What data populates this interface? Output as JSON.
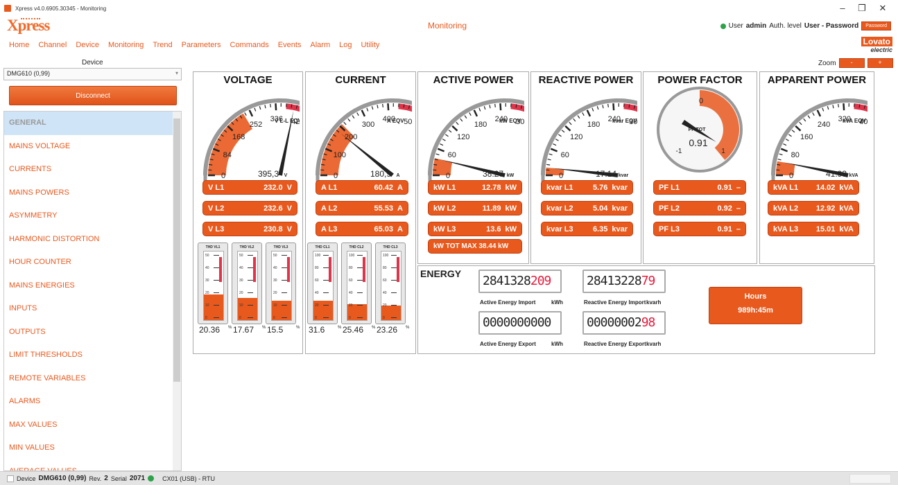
{
  "window": {
    "title": "Xpress v4.0.6905.30345 - Monitoring",
    "minimize": "–",
    "maximize": "❐",
    "close": "✕"
  },
  "app": {
    "logo": "Xpress",
    "page_title": "Monitoring"
  },
  "user": {
    "user_label": "User",
    "user_name": "admin",
    "auth_label": "Auth. level",
    "auth_value": "User - Password",
    "password_button": "Password"
  },
  "menu": [
    "Home",
    "Channel",
    "Device",
    "Monitoring",
    "Trend",
    "Parameters",
    "Commands",
    "Events",
    "Alarm",
    "Log",
    "Utility"
  ],
  "brand": {
    "name": "Lovato",
    "sub": "electric"
  },
  "device": {
    "label": "Device",
    "selected": "DMG610 (0,99)",
    "disconnect": "Disconnect"
  },
  "zoom": {
    "label": "Zoom",
    "minus": "-",
    "plus": "+"
  },
  "nav": {
    "active_index": 0,
    "items": [
      "GENERAL",
      "MAINS VOLTAGE",
      "CURRENTS",
      "MAINS POWERS",
      "ASYMMETRY",
      "HARMONIC DISTORTION",
      "HOUR COUNTER",
      "MAINS ENERGIES",
      "INPUTS",
      "OUTPUTS",
      "LIMIT THRESHOLDS",
      "REMOTE VARIABLES",
      "ALARMS",
      "MAX VALUES",
      "MIN VALUES",
      "AVERAGE VALUES"
    ]
  },
  "panels": {
    "voltage": {
      "title": "VOLTAGE",
      "gauge": {
        "ticks": [
          "0",
          "84",
          "168",
          "252",
          "336",
          "420"
        ],
        "unit": "V L-L EQV",
        "readout": "395,3",
        "readout_unit": "V",
        "max": 420,
        "value": 395.3,
        "fill_value": 230
      },
      "rows": [
        {
          "label": "V L1",
          "value": "232.0",
          "unit": "V"
        },
        {
          "label": "V L2",
          "value": "232.6",
          "unit": "V"
        },
        {
          "label": "V L3",
          "value": "230.8",
          "unit": "V"
        }
      ],
      "thd": [
        {
          "label": "THD VL1",
          "scale": [
            "50",
            "40",
            "30",
            "20",
            "10",
            "0"
          ],
          "max": 50,
          "value": 20.36,
          "display": "20.36",
          "unit": "%"
        },
        {
          "label": "THD VL2",
          "scale": [
            "50",
            "40",
            "30",
            "20",
            "10",
            "0"
          ],
          "max": 50,
          "value": 17.67,
          "display": "17.67",
          "unit": "%"
        },
        {
          "label": "THD VL3",
          "scale": [
            "50",
            "40",
            "30",
            "20",
            "10",
            "0"
          ],
          "max": 50,
          "value": 15.5,
          "display": "15.5",
          "unit": "%"
        }
      ]
    },
    "current": {
      "title": "CURRENT",
      "gauge": {
        "ticks": [
          "0",
          "100",
          "200",
          "300",
          "400",
          "500"
        ],
        "unit": "A EQV",
        "readout": "180,9",
        "readout_unit": "A",
        "max": 500,
        "value": 180.9,
        "fill_value": 210
      },
      "rows": [
        {
          "label": "A L1",
          "value": "60.42",
          "unit": "A"
        },
        {
          "label": "A L2",
          "value": "55.53",
          "unit": "A"
        },
        {
          "label": "A L3",
          "value": "65.03",
          "unit": "A"
        }
      ],
      "thd": [
        {
          "label": "THD CL1",
          "scale": [
            "100",
            "80",
            "60",
            "40",
            "20",
            "0"
          ],
          "max": 100,
          "value": 31.6,
          "display": "31.6",
          "unit": "%"
        },
        {
          "label": "THD CL2",
          "scale": [
            "100",
            "80",
            "60",
            "40",
            "20",
            "0"
          ],
          "max": 100,
          "value": 25.46,
          "display": "25.46",
          "unit": "%"
        },
        {
          "label": "THD CL3",
          "scale": [
            "100",
            "80",
            "60",
            "40",
            "20",
            "0"
          ],
          "max": 100,
          "value": 23.26,
          "display": "23.26",
          "unit": "%"
        }
      ]
    },
    "active": {
      "title": "ACTIVE POWER",
      "gauge": {
        "ticks": [
          "0",
          "60",
          "120",
          "180",
          "240",
          "300"
        ],
        "unit": "kW EQV",
        "readout": "38.27",
        "readout_unit": "kW",
        "max": 300,
        "value": 38.27,
        "fill_value": 38.27
      },
      "rows": [
        {
          "label": "kW L1",
          "value": "12.78",
          "unit": "kW"
        },
        {
          "label": "kW L2",
          "value": "11.89",
          "unit": "kW"
        },
        {
          "label": "kW L3",
          "value": "13.6",
          "unit": "kW"
        }
      ],
      "tot": "kW TOT MAX  38.44 kW"
    },
    "reactive": {
      "title": "REACTIVE POWER",
      "gauge": {
        "ticks": [
          "0",
          "60",
          "120",
          "180",
          "240",
          "300"
        ],
        "unit": "kvar EQV",
        "readout": "17.14",
        "readout_unit": "kvar",
        "max": 300,
        "value": 17.14,
        "fill_value": 17.14
      },
      "rows": [
        {
          "label": "kvar L1",
          "value": "5.76",
          "unit": "kvar"
        },
        {
          "label": "kvar L2",
          "value": "5.04",
          "unit": "kvar"
        },
        {
          "label": "kvar L3",
          "value": "6.35",
          "unit": "kvar"
        }
      ]
    },
    "pf": {
      "title": "POWER FACTOR",
      "gauge": {
        "label": "PF TOT",
        "readout": "0.91",
        "t_top": "0",
        "t_left": "-1",
        "t_right": "1",
        "value": 0.91
      },
      "rows": [
        {
          "label": "PF L1",
          "value": "0.91",
          "unit": "–"
        },
        {
          "label": "PF L2",
          "value": "0.92",
          "unit": "–"
        },
        {
          "label": "PF L3",
          "value": "0.91",
          "unit": "–"
        }
      ]
    },
    "apparent": {
      "title": "APPARENT POWER",
      "gauge": {
        "ticks": [
          "0",
          "80",
          "160",
          "240",
          "320",
          "400"
        ],
        "unit": "kVA EQV",
        "readout": "41.93",
        "readout_unit": "kVA",
        "max": 400,
        "value": 41.93,
        "fill_value": 41.93
      },
      "rows": [
        {
          "label": "kVA L1",
          "value": "14.02",
          "unit": "kVA"
        },
        {
          "label": "kVA L2",
          "value": "12.92",
          "unit": "kVA"
        },
        {
          "label": "kVA L3",
          "value": "15.01",
          "unit": "kVA"
        }
      ]
    }
  },
  "energy": {
    "title": "ENERGY",
    "meters": [
      {
        "black": "2841328",
        "red": "209",
        "label": "Active Energy Import",
        "unit": "kWh"
      },
      {
        "black": "28413228",
        "red": "79",
        "label": "Reactive Energy Import",
        "unit": "kvarh"
      },
      {
        "black": "0000000000",
        "red": "",
        "label": "Active Energy Export",
        "unit": "kWh"
      },
      {
        "black": "00000002",
        "red": "98",
        "label": "Reactive Energy Export",
        "unit": "kvarh"
      }
    ],
    "hours_label": "Hours",
    "hours_value": "989h:45m"
  },
  "status": {
    "device_label": "Device",
    "device": "DMG610 (0,99)",
    "rev_label": "Rev.",
    "rev": "2",
    "serial_label": "Serial",
    "serial": "2071",
    "port": "CX01 (USB) - RTU"
  },
  "colors": {
    "accent": "#e8591e",
    "gauge_fill": "#e8591e",
    "alarm_red": "#e0344a",
    "status_green": "#2ea24a",
    "nav_active": "#cfe5f7"
  }
}
